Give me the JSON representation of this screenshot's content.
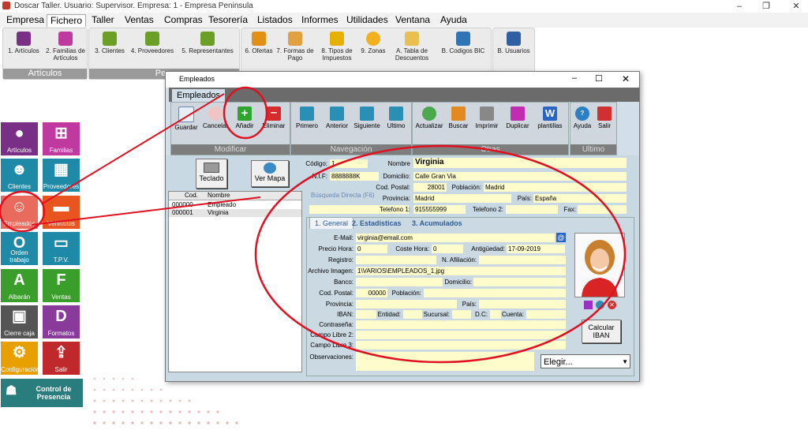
{
  "window": {
    "title": "Doscar Taller. Usuario: Supervisor. Empresa: 1 - Empresa Peninsula"
  },
  "menu": [
    "Empresa",
    "Fichero",
    "Taller",
    "Ventas",
    "Compras",
    "Tesorería",
    "Listados",
    "Informes",
    "Utilidades",
    "Ventana",
    "Ayuda"
  ],
  "ribbon": {
    "articulos_group": "Artículos",
    "personal_group": "Pers",
    "buttons": [
      "1. Artículos",
      "2. Familias de Artículos",
      "3. Clientes",
      "4. Proveedores",
      "5. Representantes",
      "6. Ofertas",
      "7. Formas de Pago",
      "8. Tipos de Impuestos",
      "9. Zonas",
      "A. Tabla de Descuentos",
      "B. Codigos BIC",
      "B. Usuarios"
    ]
  },
  "sidebar": [
    "Artículos",
    "Familias",
    "Clientes",
    "Proveedores",
    "Empleados",
    "Vehículos",
    "Orden trabajo",
    "T.P.V.",
    "Albarán",
    "Ventas",
    "Cierre caja",
    "Formatos",
    "Configuración",
    "Salir",
    "Control de Presencia"
  ],
  "dialog": {
    "title": "Empleados",
    "tab": "Empleados",
    "groups": {
      "modificar": "Modificar",
      "navegacion": "Navegación",
      "otras": "Otras",
      "ultimo": "Ultimo"
    },
    "toolbar": [
      "Guardar",
      "Cancelar",
      "Añadir",
      "Eliminar",
      "Primero",
      "Anterior",
      "Siguiente",
      "Ultimo",
      "Actualizar",
      "Buscar",
      "Imprimir",
      "Duplicar",
      "plantillas",
      "Ayuda",
      "Salir"
    ],
    "teclado": "Teclado",
    "ver_mapa": "Ver Mapa",
    "list_headers": [
      "Cod.",
      "Nombre"
    ],
    "list_rows": [
      {
        "cod": "000000",
        "nombre": "Empleado"
      },
      {
        "cod": "000001",
        "nombre": "Virginia"
      }
    ],
    "fields": {
      "codigo_l": "Código:",
      "codigo": "1",
      "nombre_l": "Nombre",
      "nombre": "Virginia",
      "nif_l": "N.I.F:",
      "nif": "8888888K",
      "domicilio_l": "Domicilio:",
      "domicilio": "Calle Gran Via",
      "cp_l": "Cod. Postal:",
      "cp": "28001",
      "poblacion_l": "Población:",
      "poblacion": "Madrid",
      "busqueda": "Búsqueda Directa (F6)",
      "provincia_l": "Provincia:",
      "provincia": "Madrid",
      "pais_l": "País:",
      "pais": "España",
      "tel1_l": "Telefono 1:",
      "tel1": "915555999",
      "tel2_l": "Telefono 2:",
      "tel2": "",
      "fax_l": "Fax:",
      "fax": ""
    },
    "subtabs": [
      "1. General",
      "2. Estadísticas",
      "3. Acumulados"
    ],
    "general": {
      "email_l": "E-Mail:",
      "email": "virginia@email.com",
      "precio_l": "Precio Hora:",
      "precio": "0",
      "coste_l": "Coste Hora:",
      "coste": "0",
      "antig_l": "Antigüedad:",
      "antig": "17-09-2019",
      "registro_l": "Registro:",
      "afil_l": "N. Afiliación:",
      "archivo_l": "Archivo Imagen:",
      "archivo": "1\\VARIOS\\EMPLEADOS_1.jpg",
      "banco_l": "Banco:",
      "domicilio_l": "Domicilio:",
      "cp_l": "Cod. Postal:",
      "cp": "00000",
      "poblacion_l": "Población:",
      "provincia_l": "Provincia:",
      "pais_l": "País:",
      "iban_l": "IBAN:",
      "entidad_l": "Entidad:",
      "sucursal_l": "Sucursal:",
      "dc_l": "D.C:",
      "cuenta_l": "Cuenta:",
      "pass_l": "Contraseña:",
      "libre2_l": "Campo Libre 2:",
      "libre3_l": "Campo Libre 3:",
      "obs_l": "Observaciones:",
      "calc_iban": "Calcular IBAN",
      "elegir": "Elegir..."
    }
  }
}
